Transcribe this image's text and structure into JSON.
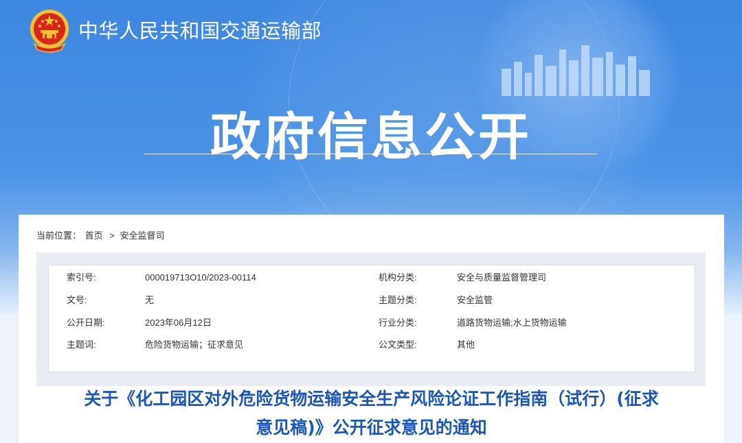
{
  "header": {
    "org_name": "中华人民共和国交通运输部",
    "banner_title": "政府信息公开"
  },
  "breadcrumb": {
    "prefix": "当前位置：",
    "home": "首页",
    "separator": ">",
    "current": "安全监督司"
  },
  "info": {
    "rows": [
      {
        "label_left": "索引号:",
        "value_left": "000019713O10/2023-00114",
        "label_right": "机构分类:",
        "value_right": "安全与质量监督管理司"
      },
      {
        "label_left": "文号:",
        "value_left": "无",
        "label_right": "主题分类:",
        "value_right": "安全监管"
      },
      {
        "label_left": "公开日期:",
        "value_left": "2023年06月12日",
        "label_right": "行业分类:",
        "value_right": "道路货物运输;水上货物运输"
      },
      {
        "label_left": "主题词:",
        "value_left": "危险货物运输；征求意见",
        "label_right": "公文类型:",
        "value_right": "其他"
      }
    ]
  },
  "document": {
    "title_line1": "关于《化工园区对外危险货物运输安全生产风险论证工作指南（试行）(征求",
    "title_line2": "意见稿)》公开征求意见的通知"
  },
  "colors": {
    "banner_blue": "#3d87e0",
    "title_blue": "#1a57b8",
    "emblem_red": "#d8261b",
    "emblem_gold": "#f3c030"
  }
}
